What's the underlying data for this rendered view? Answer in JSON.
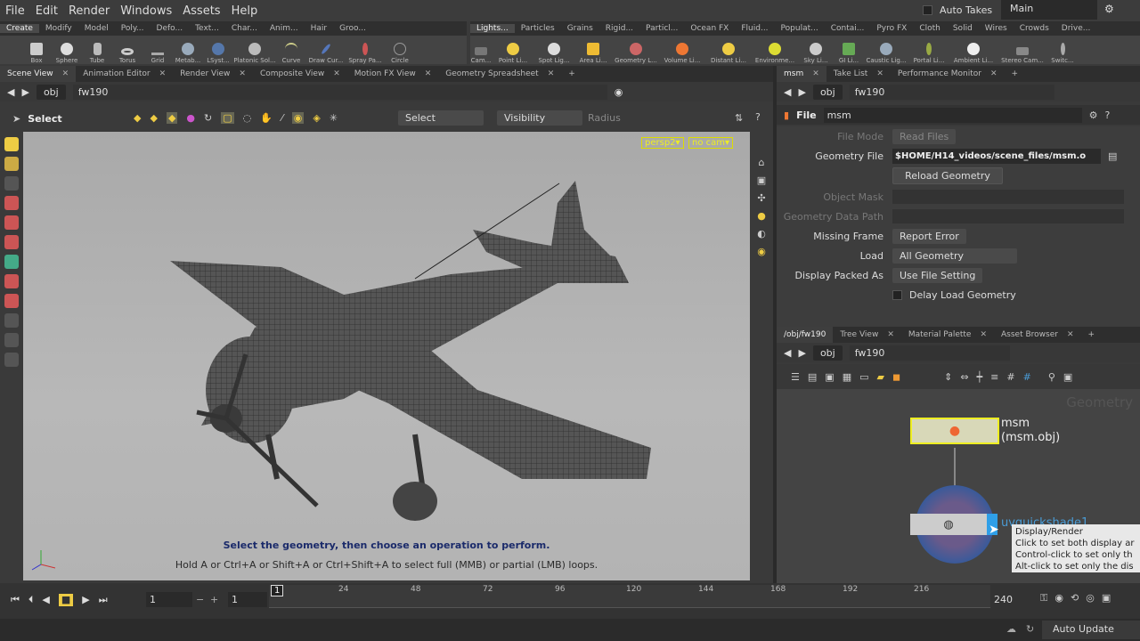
{
  "menu": [
    "File",
    "Edit",
    "Render",
    "Windows",
    "Assets",
    "Help"
  ],
  "auto_takes": "Auto Takes",
  "main_label": "Main",
  "shelf_tabs_left": [
    "Create",
    "Modify",
    "Model",
    "Poly...",
    "Defo...",
    "Text...",
    "Char...",
    "Anim...",
    "Hair",
    "Groo..."
  ],
  "shelf_tabs_right": [
    "Lights...",
    "Particles",
    "Grains",
    "Rigid...",
    "Particl...",
    "Ocean FX",
    "Fluid...",
    "Populat...",
    "Contai...",
    "Pyro FX",
    "Cloth",
    "Solid",
    "Wires",
    "Crowds",
    "Drive..."
  ],
  "tools_left": [
    "Box",
    "Sphere",
    "Tube",
    "Torus",
    "Grid",
    "Metab...",
    "LSyst...",
    "Platonic Sol...",
    "Curve",
    "Draw Cur...",
    "Spray Pa...",
    "Circle"
  ],
  "tools_right": [
    "Cam...",
    "Point Li...",
    "Spot Lig...",
    "Area Li...",
    "Geometry L...",
    "Volume Li...",
    "Distant Li...",
    "Environme...",
    "Sky Li...",
    "GI Li...",
    "Caustic Lig...",
    "Portal Li...",
    "Ambient Li...",
    "Stereo Cam...",
    "Switc..."
  ],
  "view_tabs": [
    "Scene View",
    "Animation Editor",
    "Render View",
    "Composite View",
    "Motion FX View",
    "Geometry Spreadsheet"
  ],
  "path": {
    "obj": "obj",
    "node": "fw190"
  },
  "select_tool": "Select",
  "select_menu": "Select",
  "visibility_menu": "Visibility",
  "radius_label": "Radius",
  "persp": "persp2▾",
  "nocam": "no cam▾",
  "hint1": "Select the geometry, then choose an operation to perform.",
  "hint2": "Hold A or Ctrl+A or Shift+A or Ctrl+Shift+A to select full (MMB) or partial (LMB) loops.",
  "param_tabs": [
    "msm",
    "Take List",
    "Performance Monitor"
  ],
  "param_header": {
    "type": "File",
    "name": "msm"
  },
  "params": {
    "file_mode": {
      "label": "File Mode",
      "value": "Read Files"
    },
    "geometry_file": {
      "label": "Geometry File",
      "value": "$HOME/H14_videos/scene_files/msm.o"
    },
    "reload": "Reload Geometry",
    "object_mask": "Object Mask",
    "geometry_data_path": "Geometry Data Path",
    "missing_frame": {
      "label": "Missing Frame",
      "value": "Report Error"
    },
    "load": {
      "label": "Load",
      "value": "All Geometry"
    },
    "display_packed": {
      "label": "Display Packed As",
      "value": "Use File Setting"
    },
    "delay_load": "Delay Load Geometry"
  },
  "network_tabs": [
    "/obj/fw190",
    "Tree View",
    "Material Palette",
    "Asset Browser"
  ],
  "network_label": "Geometry",
  "node1": {
    "name": "msm",
    "sub": "(msm.obj)"
  },
  "node2": {
    "name": "uvquickshade1"
  },
  "tooltip": [
    "Display/Render",
    "Click to set both display ar",
    "Control-click to set only th",
    "Alt-click to set only the dis"
  ],
  "timeline": {
    "frame": "1",
    "start": "1",
    "end": "240",
    "ticks": [
      "24",
      "48",
      "72",
      "96",
      "120",
      "144",
      "168",
      "192",
      "216"
    ],
    "cur": "1"
  },
  "auto_update": "Auto Update"
}
